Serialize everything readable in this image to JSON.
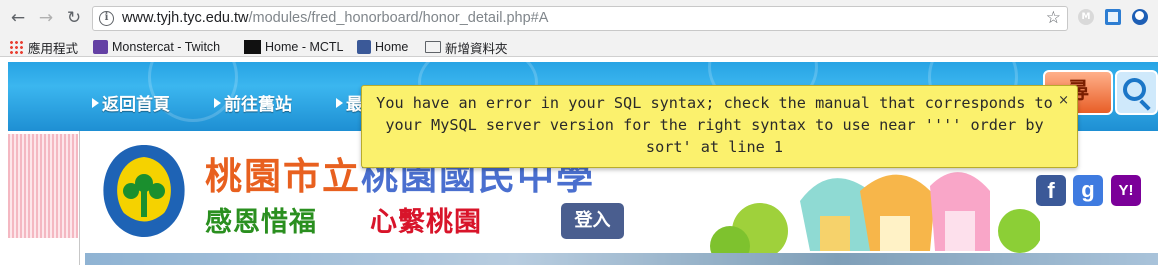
{
  "browser": {
    "url_host": "www.tyjh.tyc.edu.tw",
    "url_path": "/modules/fred_honorboard/honor_detail.php#A",
    "bookmarks": [
      {
        "label": "應用程式"
      },
      {
        "label": "Monstercat - Twitch"
      },
      {
        "label": "Home - MCTL"
      },
      {
        "label": "Home"
      },
      {
        "label": "新增資料夾"
      }
    ]
  },
  "nav": {
    "items": [
      "返回首頁",
      "前往舊站",
      "最"
    ],
    "search_label": "尋"
  },
  "header": {
    "school_name_part1": "桃園市立",
    "school_name_part2": "桃園國民中學",
    "motto_left": "感恩惜福",
    "motto_right": "心繫桃園",
    "login_label": "登入"
  },
  "social": {
    "facebook": "f",
    "google": "g",
    "yahoo": "Y!"
  },
  "error": {
    "message": "You have an error in your SQL syntax; check the manual that corresponds to your MySQL server version for the right syntax to use near '''' order by sort' at line 1",
    "close": "×"
  },
  "colors": {
    "error_bg": "#fbf16d",
    "nav_bg": "#27a3e4",
    "login_bg": "#4a5e8f"
  }
}
